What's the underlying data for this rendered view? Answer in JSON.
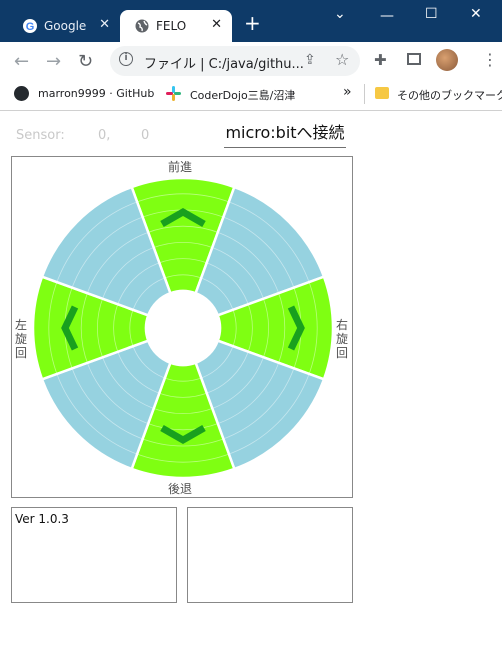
{
  "browser": {
    "tabs": [
      {
        "title": "Google",
        "icon": "google-icon"
      },
      {
        "title": "FELO",
        "icon": "globe-icon"
      }
    ],
    "address": "ファイル | C:/java/githu...",
    "bookmarks": [
      {
        "label": "marron9999 · GitHub",
        "icon": "github-icon"
      },
      {
        "label": "CoderDojo三島/沼津",
        "icon": "slack-icon"
      },
      {
        "label": "その他のブックマーク",
        "icon": "folder-icon"
      }
    ],
    "overflow": "»"
  },
  "sensor": {
    "label": "Sensor:",
    "x": "0,",
    "y": "0"
  },
  "connect_button": "micro:bitへ接続",
  "pad": {
    "forward": "前進",
    "back": "後退",
    "left_chars": [
      "左",
      "旋",
      "回"
    ],
    "right_chars": [
      "右",
      "旋",
      "回"
    ]
  },
  "version": "Ver 1.0.3",
  "colors": {
    "active_segment": "#7fff12",
    "inactive_segment": "#96d2e0",
    "arrow": "#19a01e",
    "titlebar": "#0e3a68"
  }
}
